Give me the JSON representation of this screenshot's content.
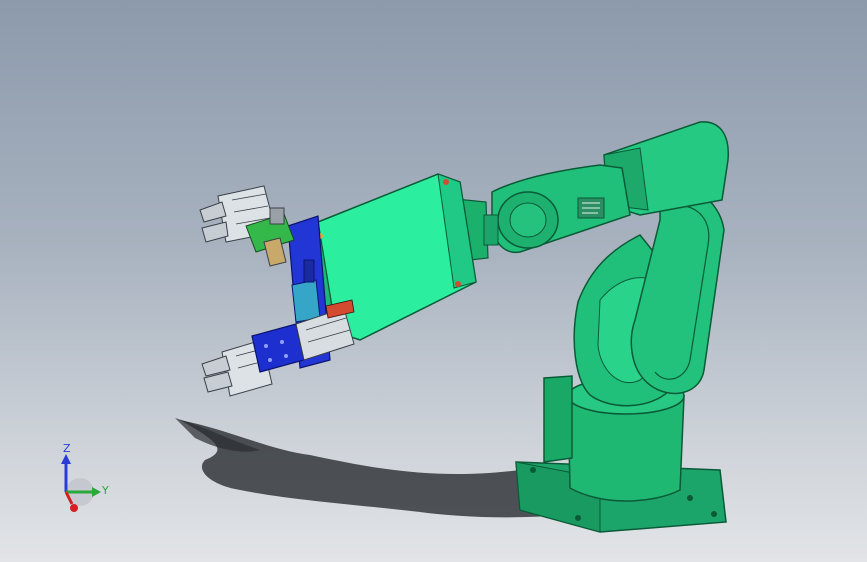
{
  "viewport": {
    "background_top": "#8c9aac",
    "background_bottom": "#e2e4e7"
  },
  "model": {
    "arm_color": "#1fbf78",
    "arm_dark": "#0f8a55",
    "tool_plate_color": "#2ef0a8",
    "bracket_blue": "#1e2fd0",
    "gripper_metal": "#d8dde2"
  },
  "triad": {
    "z_label": "Z",
    "y_label": "Y",
    "z_color": "#2a3bd8",
    "y_color": "#2aa83a",
    "x_color": "#d42020"
  }
}
